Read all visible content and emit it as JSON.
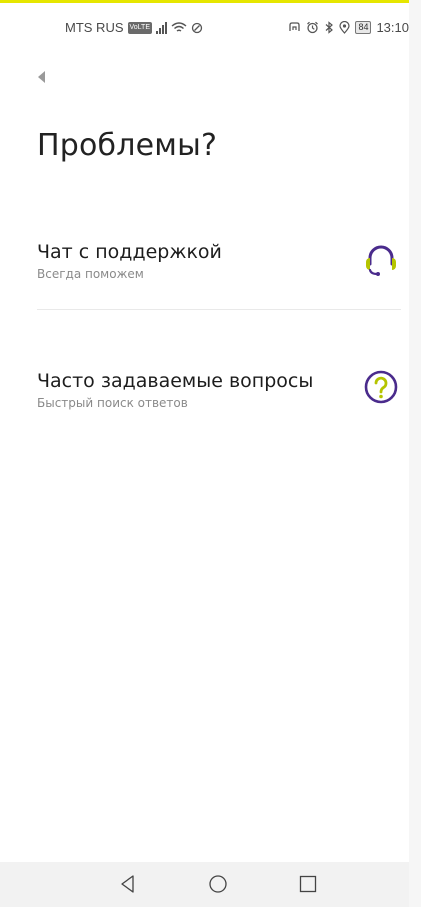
{
  "status_bar": {
    "carrier": "MTS RUS",
    "volte": "VoLTE",
    "battery": "84",
    "time": "13:10"
  },
  "header": {
    "title": "Проблемы?"
  },
  "menu": {
    "items": [
      {
        "label": "Чат с поддержкой",
        "subtitle": "Всегда поможем",
        "icon": "headset-icon"
      },
      {
        "label": "Часто задаваемые вопросы",
        "subtitle": "Быстрый поиск ответов",
        "icon": "question-icon"
      }
    ]
  },
  "colors": {
    "accent": "#b5c400",
    "brand": "#4a2b8c",
    "top_accent": "#e6e600"
  }
}
